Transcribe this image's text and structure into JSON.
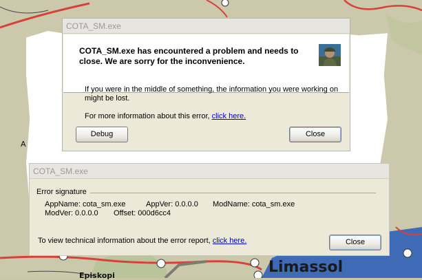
{
  "map": {
    "labels": [
      "A",
      "Limassol",
      "Episkopi"
    ]
  },
  "dialog1": {
    "title": "COTA_SM.exe",
    "heading_line1": "COTA_SM.exe has encountered a problem and needs to",
    "heading_line2": "close.  We are sorry for the inconvenience.",
    "body_line1": "If you were in the middle of something, the information you were working on",
    "body_line2": "might be lost.",
    "more_info_prefix": "For more information about this error, ",
    "more_info_link": "click here.",
    "debug_label": "Debug",
    "close_label": "Close"
  },
  "dialog2": {
    "title": "COTA_SM.exe",
    "group_label": "Error signature",
    "sig_line1_a": "AppName: cota_sm.exe",
    "sig_line1_b": "AppVer: 0.0.0.0",
    "sig_line1_c": "ModName: cota_sm.exe",
    "sig_line2_a": "ModVer: 0.0.0.0",
    "sig_line2_b": "Offset: 000d6cc4",
    "tech_prefix": "To view technical information about the error report, ",
    "tech_link": "click here.",
    "close_label": "Close"
  }
}
